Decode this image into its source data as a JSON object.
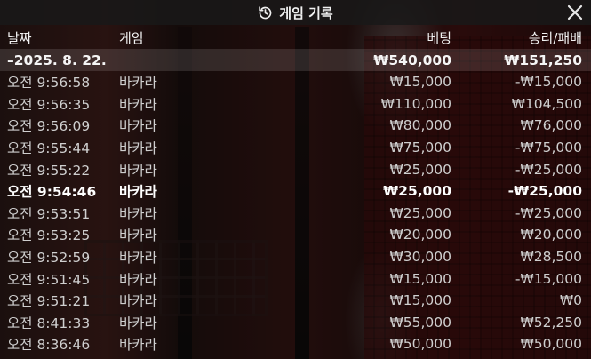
{
  "window": {
    "title": "게임 기록",
    "title_icon": "history-icon",
    "close_icon": "close-icon"
  },
  "table": {
    "columns": [
      "날짜",
      "게임",
      "베팅",
      "승리/패배"
    ],
    "summary": {
      "date": "–2025. 8. 22.",
      "bet": "₩540,000",
      "result": "₩151,250"
    },
    "rows": [
      {
        "time": "오전 9:56:58",
        "game": "바카라",
        "bet": "₩15,000",
        "result": "-₩15,000"
      },
      {
        "time": "오전 9:56:35",
        "game": "바카라",
        "bet": "₩110,000",
        "result": "₩104,500"
      },
      {
        "time": "오전 9:56:09",
        "game": "바카라",
        "bet": "₩80,000",
        "result": "₩76,000"
      },
      {
        "time": "오전 9:55:44",
        "game": "바카라",
        "bet": "₩75,000",
        "result": "-₩75,000"
      },
      {
        "time": "오전 9:55:22",
        "game": "바카라",
        "bet": "₩25,000",
        "result": "-₩25,000"
      },
      {
        "time": "오전 9:54:46",
        "game": "바카라",
        "bet": "₩25,000",
        "result": "-₩25,000"
      },
      {
        "time": "오전 9:53:51",
        "game": "바카라",
        "bet": "₩25,000",
        "result": "-₩25,000"
      },
      {
        "time": "오전 9:53:25",
        "game": "바카라",
        "bet": "₩20,000",
        "result": "₩20,000"
      },
      {
        "time": "오전 9:52:59",
        "game": "바카라",
        "bet": "₩30,000",
        "result": "₩28,500"
      },
      {
        "time": "오전 9:51:45",
        "game": "바카라",
        "bet": "₩15,000",
        "result": "-₩15,000"
      },
      {
        "time": "오전 9:51:21",
        "game": "바카라",
        "bet": "₩15,000",
        "result": "₩0"
      },
      {
        "time": "오전 8:41:33",
        "game": "바카라",
        "bet": "₩55,000",
        "result": "₩52,250"
      },
      {
        "time": "오전 8:36:46",
        "game": "바카라",
        "bet": "₩50,000",
        "result": "₩50,000"
      }
    ]
  }
}
